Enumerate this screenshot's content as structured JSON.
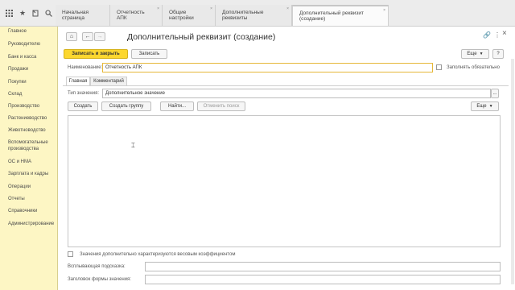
{
  "topbar": {
    "icons": [
      "apps-grid-icon",
      "star-icon",
      "history-icon",
      "search-icon"
    ],
    "tabs": [
      {
        "label": "Начальная страница"
      },
      {
        "label": "Отчетность АПК"
      },
      {
        "label": "Общие настройки"
      },
      {
        "label": "Дополнительные реквизиты"
      },
      {
        "label": "Дополнительный реквизит (создание)"
      }
    ]
  },
  "sidebar": {
    "items": [
      {
        "label": "Главное"
      },
      {
        "label": "Руководителю"
      },
      {
        "label": "Банк и касса"
      },
      {
        "label": "Продажи"
      },
      {
        "label": "Покупки"
      },
      {
        "label": "Склад"
      },
      {
        "label": "Производство"
      },
      {
        "label": "Растениеводство"
      },
      {
        "label": "Животноводство"
      },
      {
        "label": "Вспомогательные производства"
      },
      {
        "label": "ОС и НМА"
      },
      {
        "label": "Зарплата и кадры"
      },
      {
        "label": "Операции"
      },
      {
        "label": "Отчеты"
      },
      {
        "label": "Справочники"
      },
      {
        "label": "Администрирование"
      }
    ]
  },
  "form": {
    "title": "Дополнительный реквизит (создание)",
    "nav": {
      "home": "⌂",
      "back": "←",
      "forward": "→"
    },
    "window": {
      "link": "🔗",
      "menu": "⋮",
      "close": "×"
    },
    "toolbar": {
      "save_close": "Записать и закрыть",
      "save": "Записать",
      "more": "Еще",
      "help": "?"
    },
    "name": {
      "label": "Наименование:",
      "value": "Отчетность АПК",
      "required_label": "Заполнять обязательно"
    },
    "tabs": {
      "main": "Главная",
      "comment": "Комментарий"
    },
    "value_type": {
      "label": "Тип значения:",
      "value": "Дополнительное значение",
      "more": "..."
    },
    "list_toolbar": {
      "create": "Создать",
      "create_group": "Создать группу",
      "find": "Найти...",
      "cancel_search": "Отменить поиск",
      "more": "Еще"
    },
    "weight_label": "Значения дополнительно характеризуются весовым коэффициентом",
    "tooltip_label": "Всплывающая подсказка:",
    "values_form_title_label": "Заголовок формы значения:"
  }
}
